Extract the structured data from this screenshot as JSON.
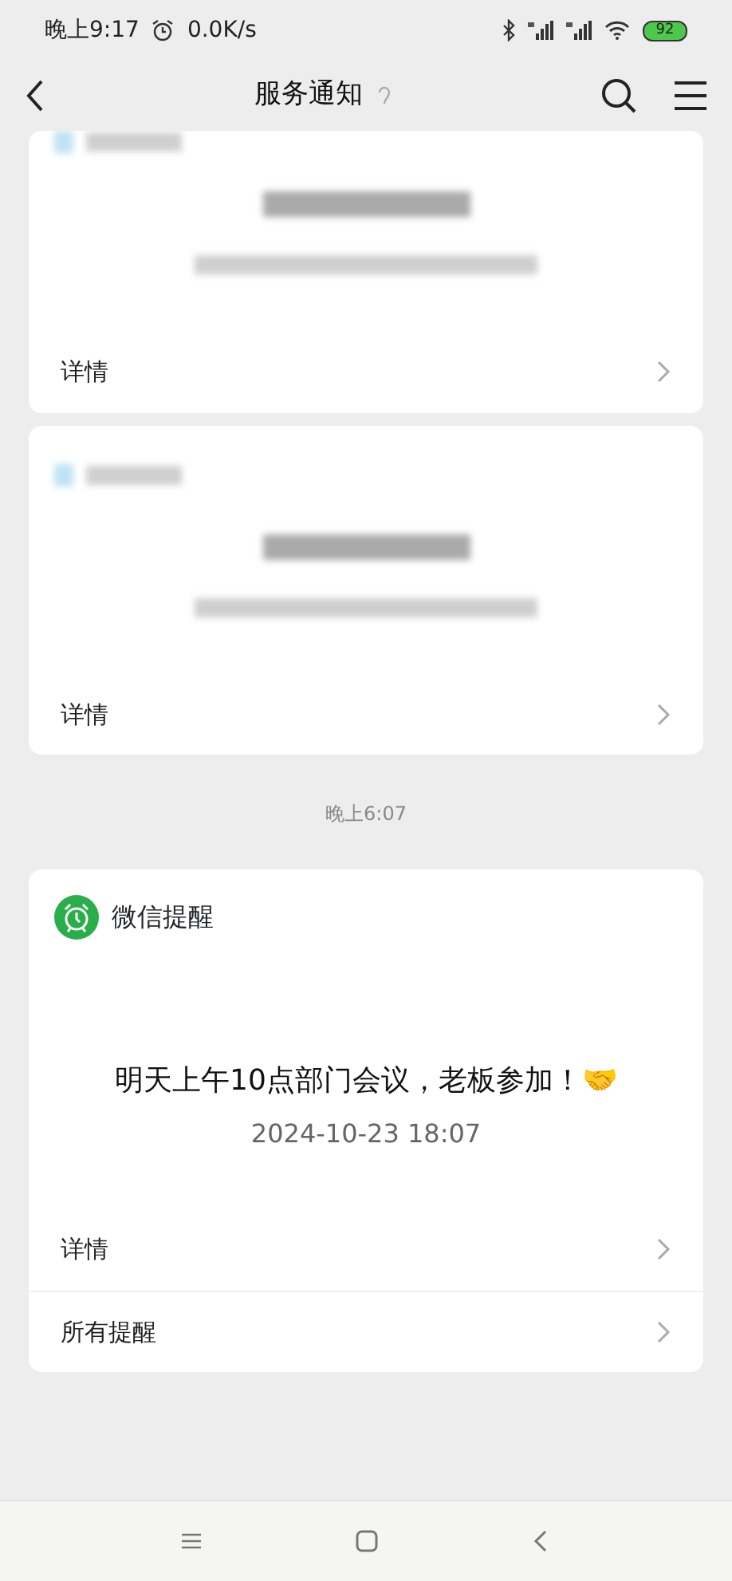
{
  "status_bar": {
    "time": "晚上9:17",
    "network_speed": "0.0K/s",
    "battery": "92"
  },
  "header": {
    "title": "服务通知"
  },
  "cards": [
    {
      "kind": "blurred",
      "links": [
        "详情"
      ]
    },
    {
      "kind": "blurred",
      "links": [
        "详情"
      ]
    }
  ],
  "timestamp": "晚上6:07",
  "reminder": {
    "app_name": "微信提醒",
    "message": "明天上午10点部门会议，老板参加！🤝",
    "datetime": "2024-10-23 18:07",
    "links": [
      "详情",
      "所有提醒"
    ]
  }
}
